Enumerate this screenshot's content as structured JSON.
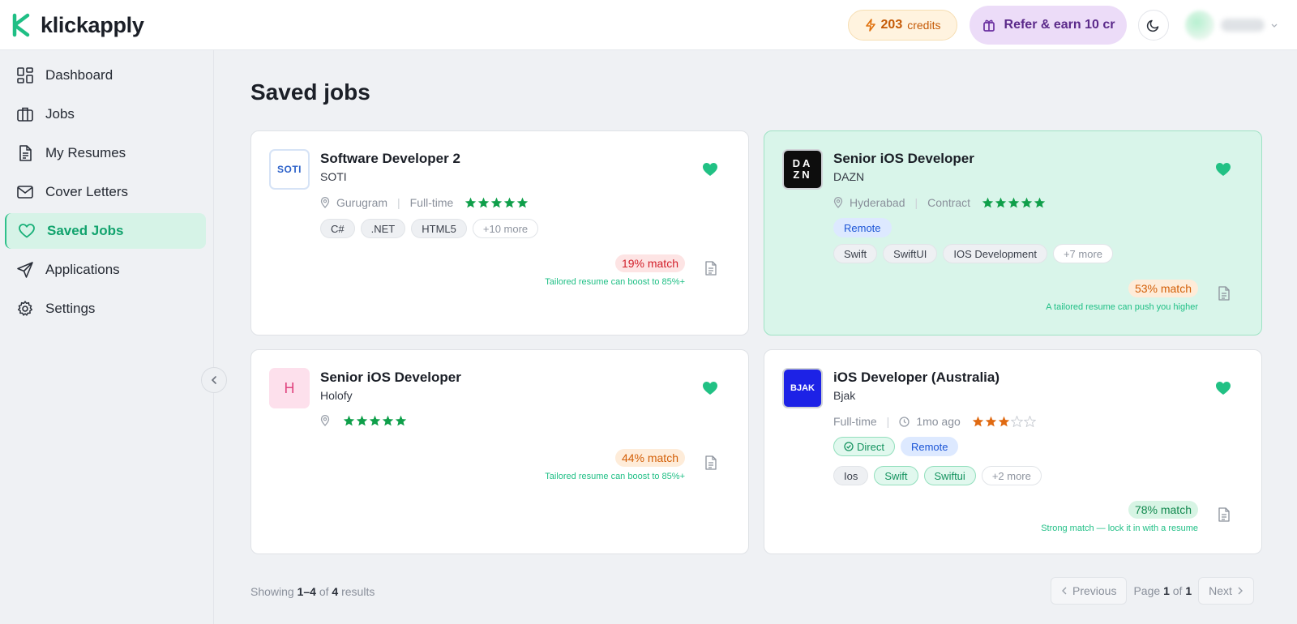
{
  "brand": {
    "name": "klickapply",
    "accent": "#1fbf85"
  },
  "header": {
    "credits": {
      "count": "203",
      "label": "credits"
    },
    "refer_label": "Refer & earn 10 cr"
  },
  "sidebar": {
    "items": [
      {
        "label": "Dashboard",
        "icon": "dashboard-icon"
      },
      {
        "label": "Jobs",
        "icon": "briefcase-icon"
      },
      {
        "label": "My Resumes",
        "icon": "document-icon"
      },
      {
        "label": "Cover Letters",
        "icon": "mail-icon"
      },
      {
        "label": "Saved Jobs",
        "icon": "heart-icon",
        "active": true
      },
      {
        "label": "Applications",
        "icon": "send-icon"
      },
      {
        "label": "Settings",
        "icon": "gear-icon"
      }
    ]
  },
  "main": {
    "title": "Saved jobs",
    "jobs": [
      {
        "title": "Software Developer 2",
        "company": "SOTI",
        "logo_text": "SOTI",
        "location": "Gurugram",
        "type": "Full-time",
        "rating": 5,
        "tags": [
          "C#",
          ".NET",
          "HTML5"
        ],
        "more": "+10 more",
        "match": "19% match",
        "hint": "Tailored resume can boost to 85%+"
      },
      {
        "title": "Senior iOS Developer",
        "company": "DAZN",
        "logo_text": [
          "DA",
          "ZN"
        ],
        "location": "Hyderabad",
        "type": "Contract",
        "rating": 5,
        "badges": [
          "Remote"
        ],
        "tags": [
          "Swift",
          "SwiftUI",
          "IOS Development"
        ],
        "more": "+7 more",
        "match": "53% match",
        "hint": "A tailored resume can push you higher"
      },
      {
        "title": "Senior iOS Developer",
        "company": "Holofy",
        "logo_text": "H",
        "rating": 5,
        "match": "44% match",
        "hint": "Tailored resume can boost to 85%+"
      },
      {
        "title": "iOS Developer (Australia)",
        "company": "Bjak",
        "logo_text": "BJAK",
        "type": "Full-time",
        "posted": "1mo ago",
        "rating": 3,
        "badges": [
          "Direct",
          "Remote"
        ],
        "tags": [
          "Ios",
          "Swift",
          "Swiftui"
        ],
        "more": "+2 more",
        "match": "78% match",
        "hint": "Strong match — lock it in with a resume"
      }
    ]
  },
  "footer": {
    "showing_prefix": "Showing",
    "range": "1–4",
    "of": "of",
    "total": "4",
    "results": "results",
    "prev": "Previous",
    "next": "Next",
    "page_label": "Page",
    "page": "1",
    "page_of": "of",
    "pages": "1"
  }
}
